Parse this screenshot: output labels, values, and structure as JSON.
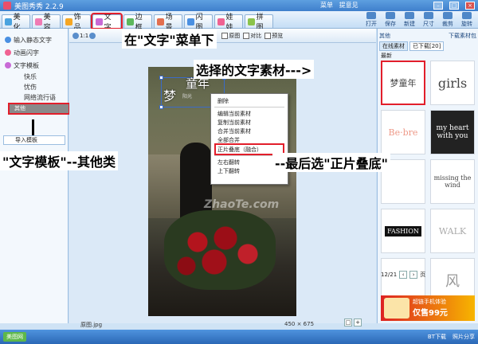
{
  "app": {
    "title": "美图秀秀 2.2.9",
    "menu_links": [
      "菜单",
      "提意见"
    ]
  },
  "tabs": [
    {
      "label": "美化",
      "color": "#4aa3df"
    },
    {
      "label": "美容",
      "color": "#f07bb4"
    },
    {
      "label": "饰品",
      "color": "#f5a623"
    },
    {
      "label": "文字",
      "color": "#c86ad6"
    },
    {
      "label": "边框",
      "color": "#5cb85c"
    },
    {
      "label": "场景",
      "color": "#e36f4f"
    },
    {
      "label": "闪图",
      "color": "#4a90e2"
    },
    {
      "label": "娃娃",
      "color": "#f06292"
    },
    {
      "label": "拼图",
      "color": "#8bc34a"
    }
  ],
  "toolbar_right": [
    "打开",
    "保存",
    "新建",
    "尺寸",
    "裁剪",
    "旋转"
  ],
  "sidebar": {
    "items": [
      "输入静态文字",
      "动画闪字",
      "文字模板"
    ],
    "sub": [
      "快乐",
      "忧伤",
      "网络流行语"
    ],
    "selected": "其他",
    "import": "导入模板"
  },
  "editbar": {
    "zoom": "1:1",
    "items": [
      "原图",
      "对比",
      "预览"
    ]
  },
  "sticker": {
    "main": "梦",
    "second": "童年",
    "small": "阳光"
  },
  "context_menu": {
    "items": [
      "删除",
      "编辑当前素材",
      "复制当前素材",
      "合并当前素材",
      "全部合并",
      "正片叠底（融合）",
      "左右翻转",
      "上下翻转"
    ],
    "highlight": "正片叠底（融合）"
  },
  "right_panel": {
    "top_tabs": [
      "其他",
      "下载素材包"
    ],
    "sub_tabs": [
      "在线素材",
      "已下载[20]"
    ],
    "sort": "最新",
    "thumbs": [
      "梦童年",
      "girls",
      "Be·bre",
      "my heart with you",
      "",
      "missing the wind",
      "FASHION",
      "WALK",
      "",
      "风"
    ],
    "page": "12/21",
    "page_btn": "页"
  },
  "status": {
    "filename": "原图.jpg",
    "dims": "450 × 675"
  },
  "taskbar": {
    "start": "美图网",
    "tray": [
      "BT下载",
      "照片分享"
    ]
  },
  "ad": {
    "line1": "超链手机体验",
    "line2": "仅售99元"
  },
  "annotations": {
    "a1": "在\"文字\"菜单下",
    "a2": "选择的文字素材--->",
    "a3": "\"文字模板\"--其他类",
    "a4": "--最后选\"正片叠底\""
  },
  "watermark": "ZhaoTe.com"
}
